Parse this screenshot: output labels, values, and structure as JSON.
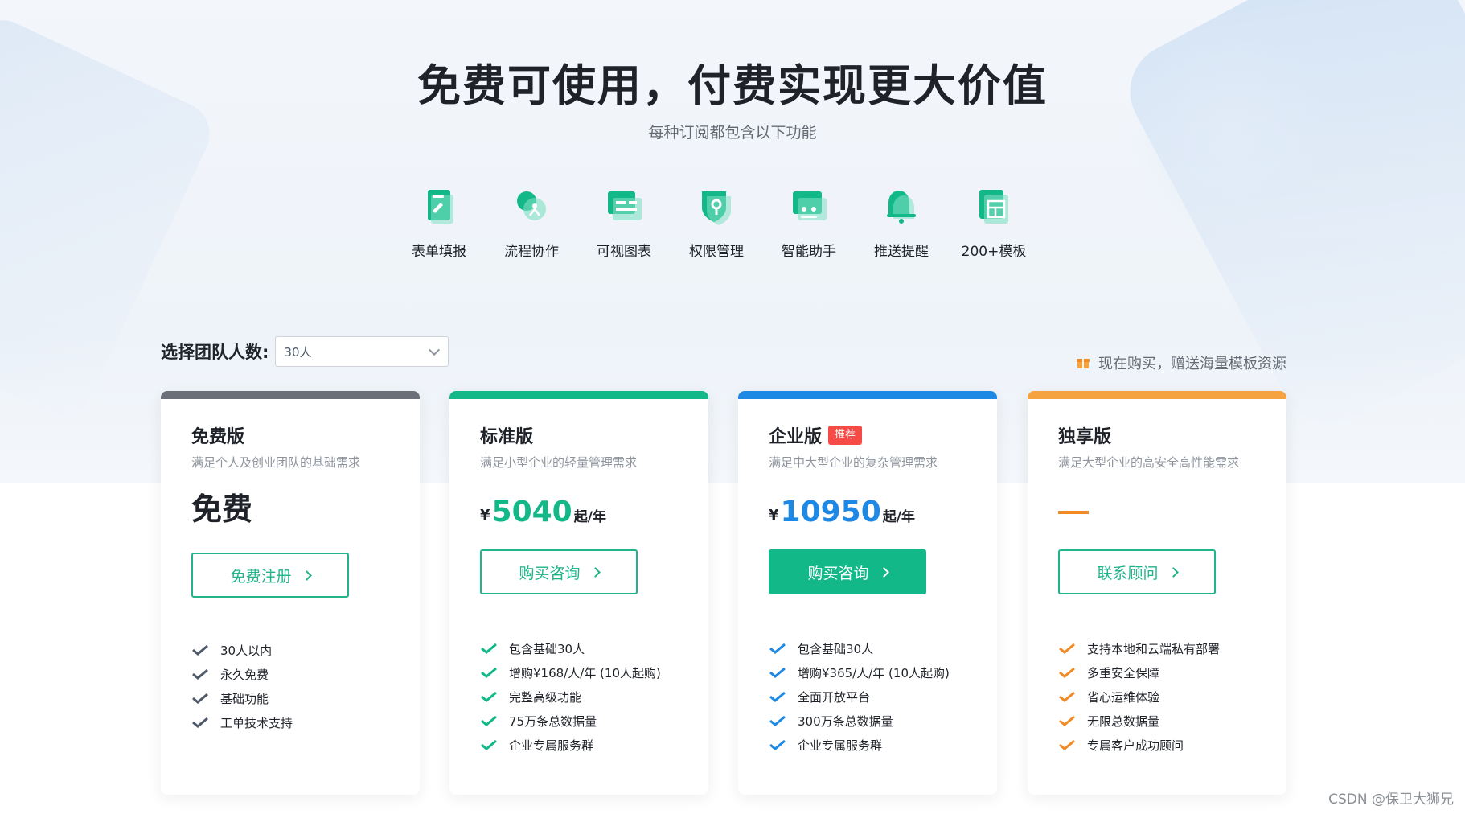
{
  "hero": {
    "title": "免费可使用，付费实现更大价值",
    "subtitle": "每种订阅都包含以下功能"
  },
  "features": [
    {
      "label": "表单填报",
      "icon": "form-fill-icon"
    },
    {
      "label": "流程协作",
      "icon": "workflow-icon"
    },
    {
      "label": "可视图表",
      "icon": "chart-icon"
    },
    {
      "label": "权限管理",
      "icon": "permission-icon"
    },
    {
      "label": "智能助手",
      "icon": "assistant-icon"
    },
    {
      "label": "推送提醒",
      "icon": "notification-icon"
    },
    {
      "label": "200+模板",
      "icon": "template-icon"
    }
  ],
  "team": {
    "label": "选择团队人数:",
    "selected": "30人"
  },
  "promo": {
    "text": "现在购买，赠送海量模板资源",
    "icon": "gift-icon"
  },
  "colors": {
    "green": "#13b889",
    "blue": "#1e88e5",
    "orange": "#f08a24",
    "gray": "#6b7078",
    "red": "#f54a45"
  },
  "plans": [
    {
      "name": "免费版",
      "desc": "满足个人及创业团队的基础需求",
      "price_text": "免费",
      "cta": "免费注册",
      "features": [
        "30人以内",
        "永久免费",
        "基础功能",
        "工单技术支持"
      ]
    },
    {
      "name": "标准版",
      "desc": "满足小型企业的轻量管理需求",
      "currency": "¥",
      "price": "5040",
      "unit": "起/年",
      "cta": "购买咨询",
      "features": [
        "包含基础30人",
        "增购¥168/人/年 (10人起购)",
        "完整高级功能",
        "75万条总数据量",
        "企业专属服务群"
      ]
    },
    {
      "name": "企业版",
      "badge": "推荐",
      "desc": "满足中大型企业的复杂管理需求",
      "currency": "¥",
      "price": "10950",
      "unit": "起/年",
      "cta": "购买咨询",
      "features": [
        "包含基础30人",
        "增购¥365/人/年 (10人起购)",
        "全面开放平台",
        "300万条总数据量",
        "企业专属服务群"
      ]
    },
    {
      "name": "独享版",
      "desc": "满足大型企业的高安全高性能需求",
      "cta": "联系顾问",
      "features": [
        "支持本地和云端私有部署",
        "多重安全保障",
        "省心运维体验",
        "无限总数据量",
        "专属客户成功顾问"
      ]
    }
  ],
  "watermark": "CSDN @保卫大狮兄"
}
